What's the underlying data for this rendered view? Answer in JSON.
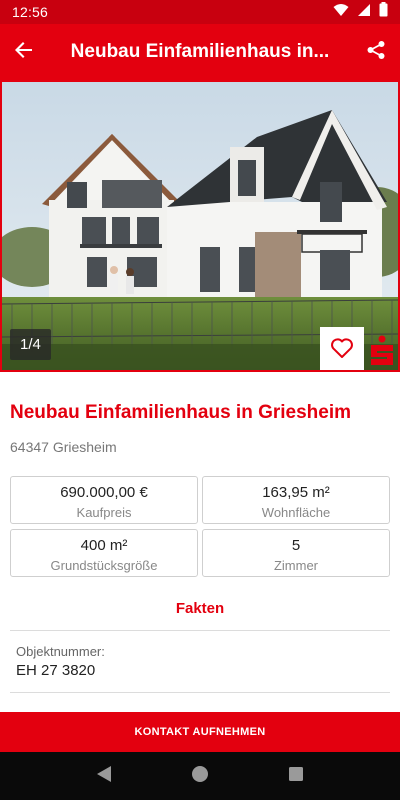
{
  "status_bar": {
    "time": "12:56"
  },
  "app_bar": {
    "title": "Neubau Einfamilienhaus in..."
  },
  "gallery": {
    "counter": "1/4"
  },
  "listing": {
    "title": "Neubau Einfamilienhaus in Griesheim",
    "location": "64347 Griesheim"
  },
  "facts": [
    {
      "value": "690.000,00 €",
      "label": "Kaufpreis"
    },
    {
      "value": "163,95 m²",
      "label": "Wohnfläche"
    },
    {
      "value": "400 m²",
      "label": "Grundstücksgröße"
    },
    {
      "value": "5",
      "label": "Zimmer"
    }
  ],
  "section": {
    "title": "Fakten"
  },
  "details": {
    "objektnummer_label": "Objektnummer:",
    "objektnummer_value": "EH 27 3820"
  },
  "contact_button": "KONTAKT AUFNEHMEN",
  "colors": {
    "brand_red": "#e3000f",
    "status_red": "#c8000f"
  },
  "icons": [
    "wifi-icon",
    "signal-icon",
    "battery-icon",
    "back-arrow-icon",
    "share-icon",
    "heart-icon",
    "sparkasse-logo-icon",
    "nav-back-icon",
    "nav-home-icon",
    "nav-recents-icon"
  ]
}
